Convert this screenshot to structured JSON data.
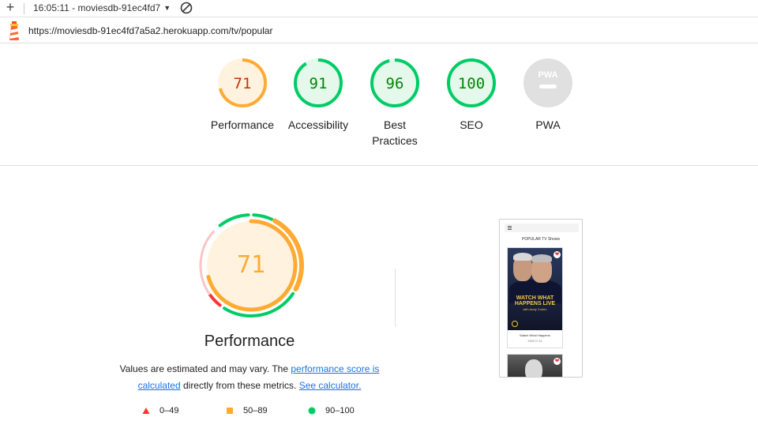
{
  "toolbar": {
    "plus_glyph": "+",
    "session": "16:05:11 - moviesdb-91ec4fd7",
    "caret": "▼"
  },
  "urlbar": {
    "url": "https://moviesdb-91ec4fd7a5a2.herokuapp.com/tv/popular"
  },
  "categories": [
    {
      "label": "Performance",
      "score": "71",
      "value": 71,
      "rating": "average",
      "color": "#fa3",
      "text_color": "#c33300",
      "fill": "#fff3e0"
    },
    {
      "label": "Accessibility",
      "score": "91",
      "value": 91,
      "rating": "pass",
      "color": "#0c6",
      "text_color": "#008800",
      "fill": "#e5f8ec"
    },
    {
      "label": "Best Practices",
      "score": "96",
      "value": 96,
      "rating": "pass",
      "color": "#0c6",
      "text_color": "#008800",
      "fill": "#e5f8ec"
    },
    {
      "label": "SEO",
      "score": "100",
      "value": 100,
      "rating": "pass",
      "color": "#0c6",
      "text_color": "#008800",
      "fill": "#e5f8ec"
    },
    {
      "label": "PWA",
      "score": "PWA",
      "value": null,
      "rating": "na",
      "color": "#ddd",
      "text_color": "#ffffff",
      "fill": "#e0e0e0"
    }
  ],
  "performance": {
    "score": "71",
    "title": "Performance",
    "note_prefix": "Values are estimated and may vary. The ",
    "link_score": "performance score is calculated",
    "note_middle": " directly from these metrics. ",
    "link_calc": "See calculator.",
    "score_color": "#fa3",
    "fill_color": "#fff3e0"
  },
  "legend": [
    {
      "shape": "triangle",
      "label": "0–49",
      "color": "#f33"
    },
    {
      "shape": "square",
      "label": "50–89",
      "color": "#fa3"
    },
    {
      "shape": "circle",
      "label": "90–100",
      "color": "#0c6"
    }
  ],
  "screenshot": {
    "page_title": "POPULAR TV Shows",
    "poster_title_1": "WATCH WHAT",
    "poster_title_2": "HAPPENS LIVE",
    "poster_sub": "with Andy Cohen",
    "caption": "Watch What Happens",
    "caption_date": "2009-07-16",
    "heart_glyph": "❤"
  }
}
